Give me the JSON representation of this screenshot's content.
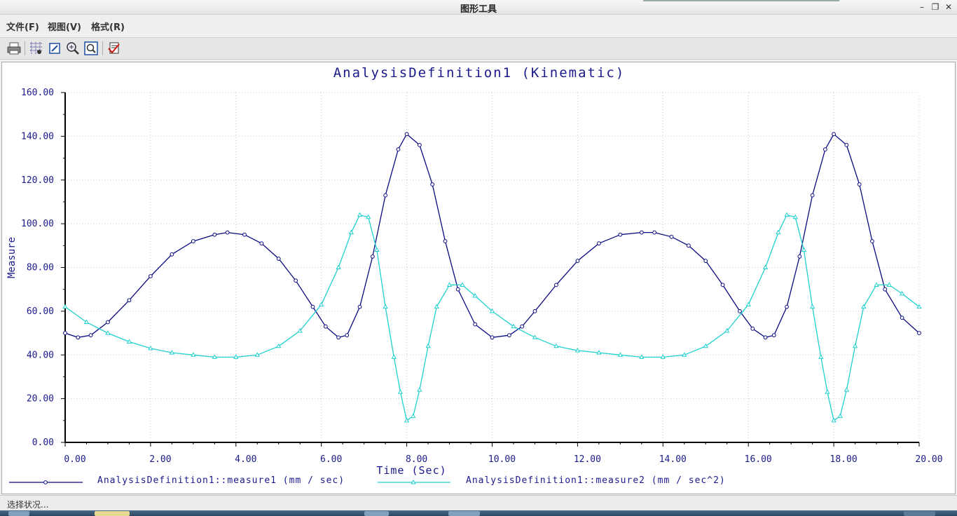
{
  "window": {
    "title": "图形工具",
    "controls": [
      "minimize-icon",
      "restore-icon",
      "close-icon"
    ]
  },
  "menubar": {
    "items": [
      {
        "label": "文件(F)"
      },
      {
        "label": "视图(V)"
      },
      {
        "label": "格式(R)"
      }
    ]
  },
  "toolbar": {
    "icons": [
      "print-icon",
      "grid-icon",
      "edit-graph-icon",
      "zoom-in-icon",
      "zoom-fit-icon",
      "export-icon"
    ]
  },
  "status": {
    "text": "选择状况..."
  },
  "colors": {
    "axis": "#000000",
    "text": "#1a1a8c",
    "measure1": "#0a0a80",
    "measure2": "#20d0d0",
    "grid": "#c8c8c8"
  },
  "chart_data": {
    "type": "line",
    "title": "AnalysisDefinition1 (Kinematic)",
    "xlabel": "Time (Sec)",
    "ylabel": "Measure",
    "xlim": [
      0,
      20
    ],
    "ylim": [
      0,
      160
    ],
    "grid": true,
    "legend_position": "bottom",
    "x_ticks": [
      "0.00",
      "2.00",
      "4.00",
      "6.00",
      "8.00",
      "10.00",
      "12.00",
      "14.00",
      "16.00",
      "18.00",
      "20.00"
    ],
    "y_ticks": [
      "0.00",
      "20.00",
      "40.00",
      "60.00",
      "80.00",
      "100.00",
      "120.00",
      "140.00",
      "160.00"
    ],
    "series": [
      {
        "name": "AnalysisDefinition1::measure1 (mm / sec)",
        "marker": "circle",
        "x": [
          0.0,
          0.3,
          0.6,
          1.0,
          1.5,
          2.0,
          2.5,
          3.0,
          3.5,
          3.8,
          4.2,
          4.6,
          5.0,
          5.4,
          5.8,
          6.1,
          6.4,
          6.6,
          6.9,
          7.2,
          7.5,
          7.8,
          8.0,
          8.3,
          8.6,
          8.9,
          9.2,
          9.6,
          10.0,
          10.4,
          10.7,
          11.0,
          11.5,
          12.0,
          12.5,
          13.0,
          13.5,
          13.8,
          14.2,
          14.6,
          15.0,
          15.4,
          15.8,
          16.1,
          16.4,
          16.6,
          16.9,
          17.2,
          17.5,
          17.8,
          18.0,
          18.3,
          18.6,
          18.9,
          19.2,
          19.6,
          20.0
        ],
        "y": [
          50,
          48,
          49,
          55,
          65,
          76,
          86,
          92,
          95,
          96,
          95,
          91,
          84,
          74,
          62,
          53,
          48,
          49,
          62,
          85,
          113,
          134,
          141,
          136,
          118,
          92,
          70,
          54,
          48,
          49,
          53,
          60,
          72,
          83,
          91,
          95,
          96,
          96,
          94,
          90,
          83,
          72,
          60,
          52,
          48,
          49,
          62,
          85,
          113,
          134,
          141,
          136,
          118,
          92,
          70,
          57,
          50
        ]
      },
      {
        "name": "AnalysisDefinition1::measure2 (mm / sec^2)",
        "marker": "triangle",
        "x": [
          0.0,
          0.5,
          1.0,
          1.5,
          2.0,
          2.5,
          3.0,
          3.5,
          4.0,
          4.5,
          5.0,
          5.5,
          6.0,
          6.4,
          6.7,
          6.9,
          7.1,
          7.3,
          7.5,
          7.7,
          7.85,
          8.0,
          8.15,
          8.3,
          8.5,
          8.7,
          9.0,
          9.3,
          9.6,
          10.0,
          10.5,
          11.0,
          11.5,
          12.0,
          12.5,
          13.0,
          13.5,
          14.0,
          14.5,
          15.0,
          15.5,
          16.0,
          16.4,
          16.7,
          16.9,
          17.1,
          17.3,
          17.5,
          17.7,
          17.85,
          18.0,
          18.15,
          18.3,
          18.5,
          18.7,
          19.0,
          19.3,
          19.6,
          20.0
        ],
        "y": [
          62,
          55,
          50,
          46,
          43,
          41,
          40,
          39,
          39,
          40,
          44,
          51,
          63,
          80,
          96,
          104,
          103,
          88,
          62,
          39,
          23,
          10,
          12,
          24,
          44,
          62,
          72,
          72,
          67,
          60,
          53,
          48,
          44,
          42,
          41,
          40,
          39,
          39,
          40,
          44,
          51,
          63,
          80,
          96,
          104,
          103,
          88,
          62,
          39,
          23,
          10,
          12,
          24,
          44,
          62,
          72,
          72,
          68,
          62
        ]
      }
    ]
  }
}
